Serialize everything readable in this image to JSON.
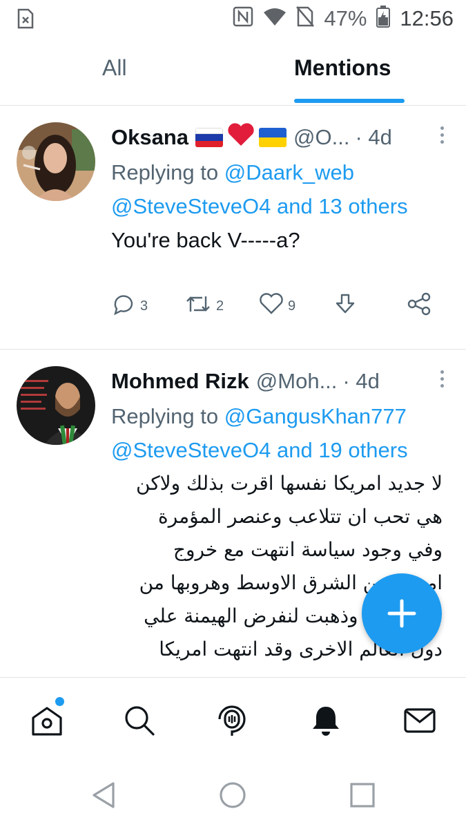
{
  "status_bar": {
    "battery_percent": "47%",
    "time": "12:56",
    "icons": [
      "sim-alert-icon",
      "nfc-icon",
      "wifi-icon",
      "no-sim-icon",
      "battery-icon"
    ]
  },
  "tabs": [
    {
      "label": "All",
      "active": false
    },
    {
      "label": "Mentions",
      "active": true
    }
  ],
  "tweets": [
    {
      "name": "Oksana",
      "flags": [
        "russia-flag-emoji",
        "red-heart-emoji",
        "ukraine-flag-emoji"
      ],
      "handle": "@O...",
      "time": "· 4d",
      "replying_to_prefix": "Replying to ",
      "replying_to_user": "@Daark_web",
      "replying_to_rest": "@SteveSteveO4 and 13 others",
      "text": "You're back V-----a?",
      "replies": "3",
      "retweets": "2",
      "likes": "9"
    },
    {
      "name": "Mohmed Rizk",
      "handle": "@Moh...",
      "time": "· 4d",
      "replying_to_prefix": "Replying to ",
      "replying_to_user": "@GangusKhan777",
      "replying_to_rest": "@SteveSteveO4 and 19 others",
      "text_lines": [
        "لا جديد امريكا نفسها اقرت بذلك ولاكن",
        "هي تحب ان تتلاعب وعنصر المؤمرة",
        "وفي وجود سياسة انتهت مع خروج",
        "امريكا من الشرق الاوسط وهروبها من",
        "افغانستان وذهبت لنفرض الهيمنة علي",
        "دول العالم الاخرى وقد انتهت امريكا"
      ]
    }
  ],
  "fab": {
    "label": "+"
  },
  "bottom_nav": [
    "home-icon",
    "search-icon",
    "spaces-icon",
    "notifications-icon",
    "messages-icon"
  ],
  "system_nav": [
    "back-icon",
    "home-circle-icon",
    "recents-icon"
  ],
  "colors": {
    "accent": "#1d9bf0",
    "text": "#0f1419",
    "secondary": "#536471"
  }
}
